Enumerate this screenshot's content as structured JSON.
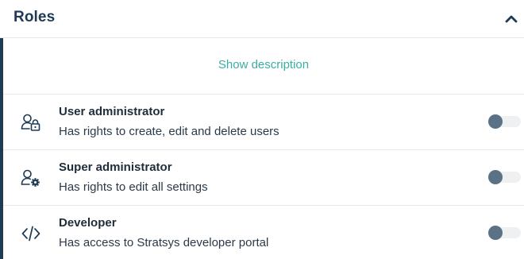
{
  "header": {
    "title": "Roles",
    "collapse_icon": "chevron-up-icon"
  },
  "show_description_label": "Show description",
  "colors": {
    "primary": "#1f3a52",
    "link": "#3aaea3",
    "toggle_knob": "#5a7186",
    "toggle_track": "#eef0f2"
  },
  "roles": [
    {
      "name": "User administrator",
      "description": "Has rights to create, edit and delete users",
      "icon": "user-lock-icon",
      "enabled": false
    },
    {
      "name": "Super administrator",
      "description": "Has rights to edit all settings",
      "icon": "user-gear-icon",
      "enabled": false
    },
    {
      "name": "Developer",
      "description": "Has access to Stratsys developer portal",
      "icon": "code-icon",
      "enabled": false
    }
  ]
}
